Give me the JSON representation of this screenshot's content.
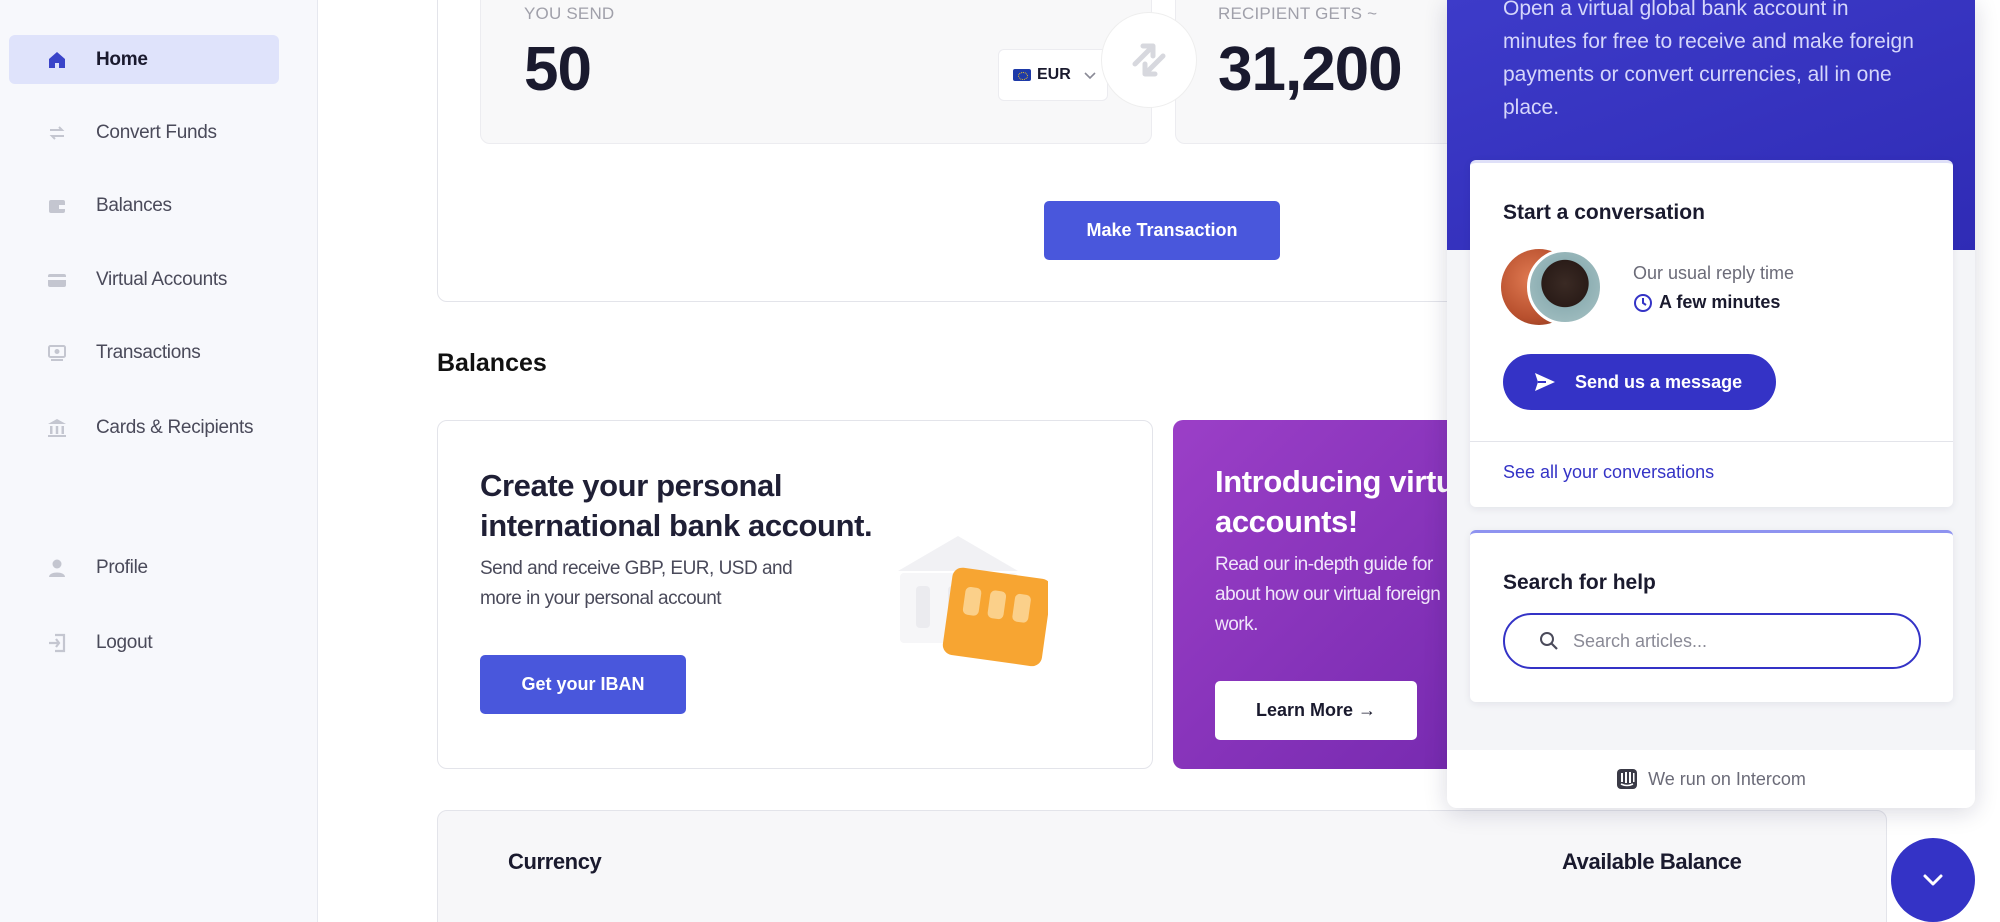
{
  "sidebar": {
    "items": [
      {
        "label": "Home",
        "icon": "home-icon",
        "active": true
      },
      {
        "label": "Convert Funds",
        "icon": "convert-icon",
        "active": false
      },
      {
        "label": "Balances",
        "icon": "wallet-icon",
        "active": false
      },
      {
        "label": "Virtual Accounts",
        "icon": "card-icon",
        "active": false
      },
      {
        "label": "Transactions",
        "icon": "transactions-icon",
        "active": false
      },
      {
        "label": "Cards & Recipients",
        "icon": "bank-icon",
        "active": false
      },
      {
        "label": "Profile",
        "icon": "user-icon",
        "active": false
      },
      {
        "label": "Logout",
        "icon": "logout-icon",
        "active": false
      }
    ]
  },
  "exchange": {
    "send_label": "YOU SEND",
    "send_amount": "50",
    "send_currency": "EUR",
    "receive_label": "RECIPIENT GETS ~",
    "receive_amount": "31,200",
    "make_transaction": "Make Transaction"
  },
  "balances": {
    "section_title": "Balances",
    "promo1": {
      "title": "Create your personal international bank account.",
      "text": "Send and receive GBP, EUR, USD and more in your personal account",
      "button": "Get your IBAN"
    },
    "promo2": {
      "title": "Introducing virtual bank accounts!",
      "text": "Read our in-depth guide for about how our virtual foreign work.",
      "button": "Learn More →"
    },
    "table": {
      "col_currency": "Currency",
      "col_balance": "Available Balance"
    }
  },
  "widget": {
    "intro": "Open a virtual global bank account in minutes for free to receive and make foreign payments or convert currencies, all in one place.",
    "conversation_title": "Start a conversation",
    "reply_label": "Our usual reply time",
    "reply_time": "A few minutes",
    "send_button": "Send us a message",
    "see_all": "See all your conversations",
    "search_title": "Search for help",
    "search_placeholder": "Search articles...",
    "footer": "We run on Intercom"
  },
  "colors": {
    "accent": "#4957dc",
    "widget_accent": "#3433c6",
    "promo_purple": "#7a2cb2"
  }
}
